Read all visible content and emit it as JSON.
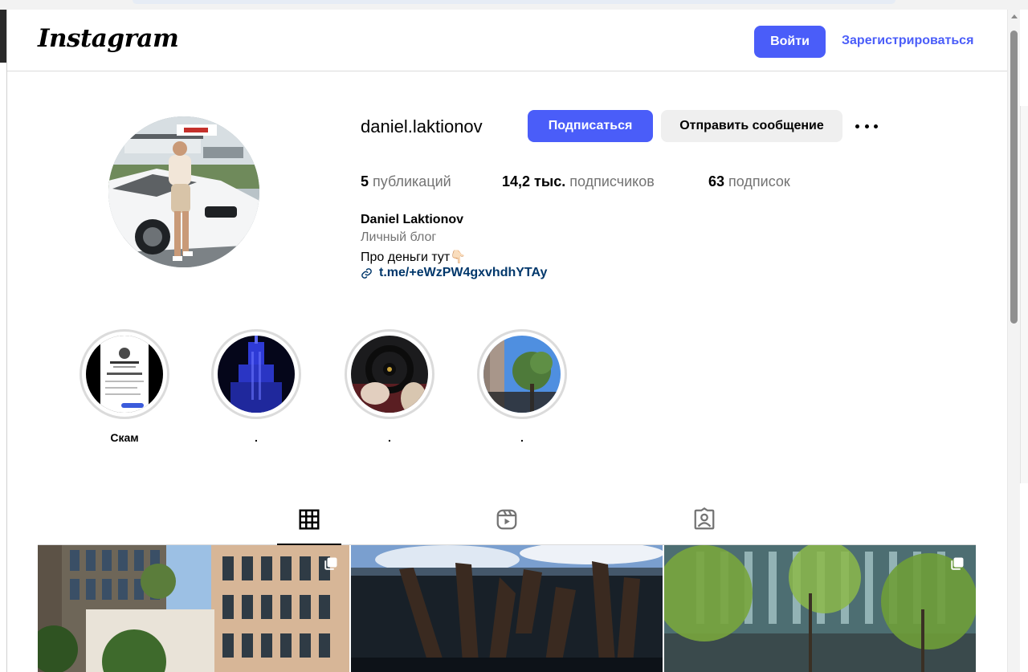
{
  "header": {
    "logo": "Instagram",
    "login_label": "Войти",
    "signup_label": "Зарегистрироваться"
  },
  "profile": {
    "username": "daniel.laktionov",
    "follow_label": "Подписаться",
    "message_label": "Отправить сообщение",
    "stats": {
      "posts_value": "5",
      "posts_label": "публикаций",
      "followers_value": "14,2 тыс.",
      "followers_label": "подписчиков",
      "following_value": "63",
      "following_label": "подписок"
    },
    "bio": {
      "name": "Daniel Laktionov",
      "category": "Личный блог",
      "text": "Про деньги тут👇🏻",
      "link": "t.me/+eWzPW4gxvhdhYTAy"
    }
  },
  "highlights": [
    {
      "label": "Скам"
    },
    {
      "label": "."
    },
    {
      "label": "."
    },
    {
      "label": "."
    }
  ],
  "tabs": [
    "grid-icon",
    "reels-icon",
    "tagged-icon"
  ],
  "colors": {
    "accent": "#4a5df9",
    "link": "#00376b",
    "muted": "#737373"
  }
}
